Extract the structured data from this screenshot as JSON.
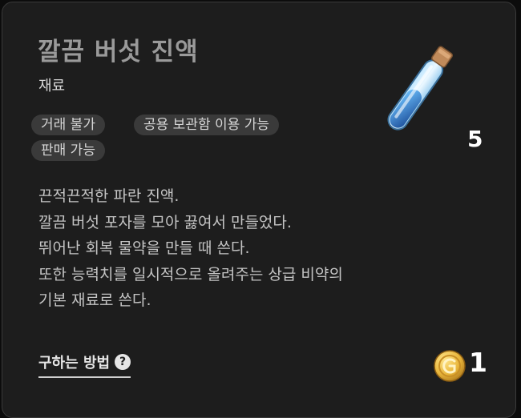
{
  "item": {
    "name": "깔끔 버섯 진액",
    "category": "재료",
    "tags": [
      "거래 불가",
      "공용 보관함 이용 가능",
      "판매 가능"
    ],
    "quantity": "5",
    "icon": "blue-potion-vial-icon"
  },
  "description": {
    "lines": [
      "끈적끈적한 파란 진액.",
      "깔끔 버섯 포자를 모아 끓여서 만들었다.",
      "뛰어난 회복 물약을 만들 때 쓴다.",
      "또한 능력치를 일시적으로 올려주는 상급 비약의",
      "기본 재료로 쓴다."
    ]
  },
  "footer": {
    "how_to_obtain": "구하는 방법",
    "help_icon": "?",
    "coin_icon": "gold-coin-icon",
    "price": "1"
  },
  "colors": {
    "background": "#1d1d1d",
    "title": "#9a9a9a",
    "tag_bg": "#3a3a3a",
    "coin_gold": "#e8b53a",
    "potion_blue": "#3f8bd6"
  }
}
